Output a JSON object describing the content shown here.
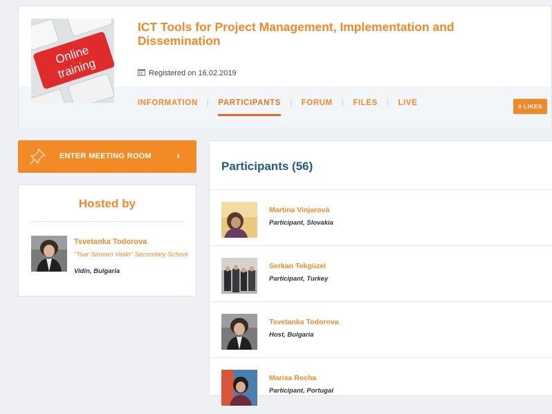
{
  "course": {
    "title": "ICT Tools for Project Management, Implementation and Dissemination",
    "registered_label": "Registered on 16.02.2019",
    "thumbnail_text": "Online training",
    "thumbnail_icon": "calendar-icon"
  },
  "tabs": [
    {
      "label": "INFORMATION",
      "active": false
    },
    {
      "label": "PARTICIPANTS",
      "active": true
    },
    {
      "label": "FORUM",
      "active": false
    },
    {
      "label": "FILES",
      "active": false
    },
    {
      "label": "LIVE",
      "active": false
    }
  ],
  "likes_label": "# LIKES",
  "enter_meeting": {
    "label": "ENTER MEETING ROOM",
    "icon": "pin-icon",
    "chevron": "›"
  },
  "hosted": {
    "title": "Hosted by",
    "name": "Tsvetanka Todorova",
    "school": "\"Tsar Simeon Veliki\" Secondary School",
    "location": "Vidin, Bulgaria"
  },
  "participants": {
    "heading": "Participants (56)",
    "items": [
      {
        "name": "Martina Vinjarová",
        "role": "Participant, Slovakia"
      },
      {
        "name": "Serkan Tekgüzel",
        "role": "Participant, Turkey"
      },
      {
        "name": "Tsvetanka Todorova",
        "role": "Host, Bulgaria"
      },
      {
        "name": "Marisa Rocha",
        "role": "Participant, Portugal"
      }
    ]
  },
  "colors": {
    "accent": "#f0892a",
    "heading_blue": "#235a85"
  }
}
